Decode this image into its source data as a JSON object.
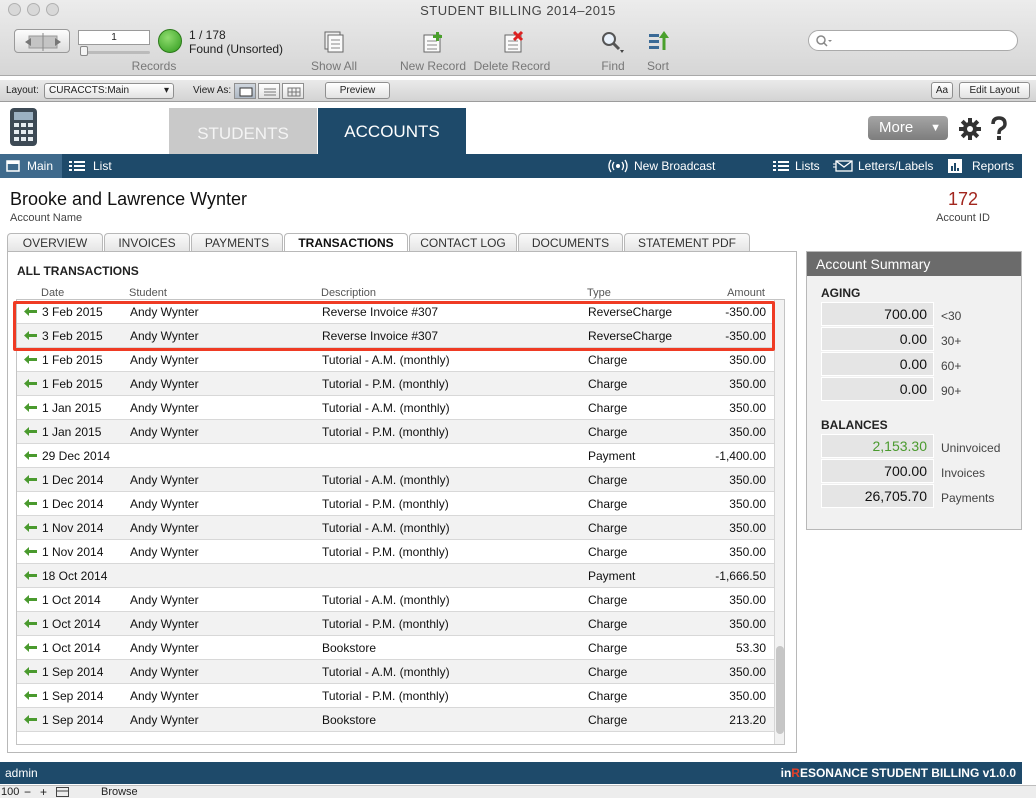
{
  "window": {
    "title": "STUDENT BILLING 2014–2015"
  },
  "toolbar": {
    "record_input": "1",
    "found_count": "1 / 178",
    "found_state": "Found (Unsorted)",
    "records_label": "Records",
    "show_all": "Show All",
    "new_record": "New Record",
    "delete_record": "Delete Record",
    "find": "Find",
    "sort": "Sort"
  },
  "layout_bar": {
    "layout_label": "Layout:",
    "layout_value": "CURACCTS:Main",
    "view_as_label": "View As:",
    "preview": "Preview",
    "aa": "Aa",
    "edit_layout": "Edit Layout"
  },
  "main_tabs": {
    "students": "STUDENTS",
    "accounts": "ACCOUNTS",
    "more": "More"
  },
  "navbar": {
    "main": "Main",
    "list": "List",
    "new_broadcast": "New Broadcast",
    "lists": "Lists",
    "letters_labels": "Letters/Labels",
    "reports": "Reports"
  },
  "account": {
    "name": "Brooke and Lawrence Wynter",
    "name_label": "Account Name",
    "id": "172",
    "id_label": "Account ID"
  },
  "subtabs": [
    "OVERVIEW",
    "INVOICES",
    "PAYMENTS",
    "TRANSACTIONS",
    "CONTACT LOG",
    "DOCUMENTS",
    "STATEMENT PDF"
  ],
  "transactions": {
    "title": "ALL TRANSACTIONS",
    "columns": {
      "date": "Date",
      "student": "Student",
      "description": "Description",
      "type": "Type",
      "amount": "Amount"
    },
    "rows": [
      {
        "date": "3 Feb 2015",
        "student": "Andy Wynter",
        "description": "Reverse Invoice #307",
        "type": "ReverseCharge",
        "amount": "-350.00"
      },
      {
        "date": "3 Feb 2015",
        "student": "Andy Wynter",
        "description": "Reverse Invoice #307",
        "type": "ReverseCharge",
        "amount": "-350.00"
      },
      {
        "date": "1 Feb 2015",
        "student": "Andy Wynter",
        "description": "Tutorial - A.M. (monthly)",
        "type": "Charge",
        "amount": "350.00"
      },
      {
        "date": "1 Feb 2015",
        "student": "Andy Wynter",
        "description": "Tutorial - P.M. (monthly)",
        "type": "Charge",
        "amount": "350.00"
      },
      {
        "date": "1 Jan 2015",
        "student": "Andy Wynter",
        "description": "Tutorial - A.M. (monthly)",
        "type": "Charge",
        "amount": "350.00"
      },
      {
        "date": "1 Jan 2015",
        "student": "Andy Wynter",
        "description": "Tutorial - P.M. (monthly)",
        "type": "Charge",
        "amount": "350.00"
      },
      {
        "date": "29 Dec 2014",
        "student": "",
        "description": "",
        "type": "Payment",
        "amount": "-1,400.00"
      },
      {
        "date": "1 Dec 2014",
        "student": "Andy Wynter",
        "description": "Tutorial - A.M. (monthly)",
        "type": "Charge",
        "amount": "350.00"
      },
      {
        "date": "1 Dec 2014",
        "student": "Andy Wynter",
        "description": "Tutorial - P.M. (monthly)",
        "type": "Charge",
        "amount": "350.00"
      },
      {
        "date": "1 Nov 2014",
        "student": "Andy Wynter",
        "description": "Tutorial - A.M. (monthly)",
        "type": "Charge",
        "amount": "350.00"
      },
      {
        "date": "1 Nov 2014",
        "student": "Andy Wynter",
        "description": "Tutorial - P.M. (monthly)",
        "type": "Charge",
        "amount": "350.00"
      },
      {
        "date": "18 Oct 2014",
        "student": "",
        "description": "",
        "type": "Payment",
        "amount": "-1,666.50"
      },
      {
        "date": "1 Oct 2014",
        "student": "Andy Wynter",
        "description": "Tutorial - A.M. (monthly)",
        "type": "Charge",
        "amount": "350.00"
      },
      {
        "date": "1 Oct 2014",
        "student": "Andy Wynter",
        "description": "Tutorial - P.M. (monthly)",
        "type": "Charge",
        "amount": "350.00"
      },
      {
        "date": "1 Oct 2014",
        "student": "Andy Wynter",
        "description": "Bookstore",
        "type": "Charge",
        "amount": "53.30"
      },
      {
        "date": "1 Sep 2014",
        "student": "Andy Wynter",
        "description": "Tutorial - A.M. (monthly)",
        "type": "Charge",
        "amount": "350.00"
      },
      {
        "date": "1 Sep 2014",
        "student": "Andy Wynter",
        "description": "Tutorial - P.M. (monthly)",
        "type": "Charge",
        "amount": "350.00"
      },
      {
        "date": "1 Sep 2014",
        "student": "Andy Wynter",
        "description": "Bookstore",
        "type": "Charge",
        "amount": "213.20"
      }
    ]
  },
  "summary": {
    "title": "Account Summary",
    "aging_title": "AGING",
    "aging": [
      {
        "value": "700.00",
        "label": "<30"
      },
      {
        "value": "0.00",
        "label": "30+"
      },
      {
        "value": "0.00",
        "label": "60+"
      },
      {
        "value": "0.00",
        "label": "90+"
      }
    ],
    "balances_title": "BALANCES",
    "balances": [
      {
        "value": "2,153.30",
        "label": "Uninvoiced"
      },
      {
        "value": "700.00",
        "label": "Invoices"
      },
      {
        "value": "26,705.70",
        "label": "Payments"
      }
    ]
  },
  "footer": {
    "user": "admin",
    "brand_prefix": "in",
    "brand_r": "R",
    "brand_rest": "ESONANCE STUDENT BILLING v1.0.0"
  },
  "statusbar": {
    "zoom": "100",
    "mode": "Browse"
  },
  "colors": {
    "navy": "#1e4a6a",
    "accent_red": "#ef3b24",
    "id_red": "#a2261e",
    "green": "#4a9a2e"
  }
}
